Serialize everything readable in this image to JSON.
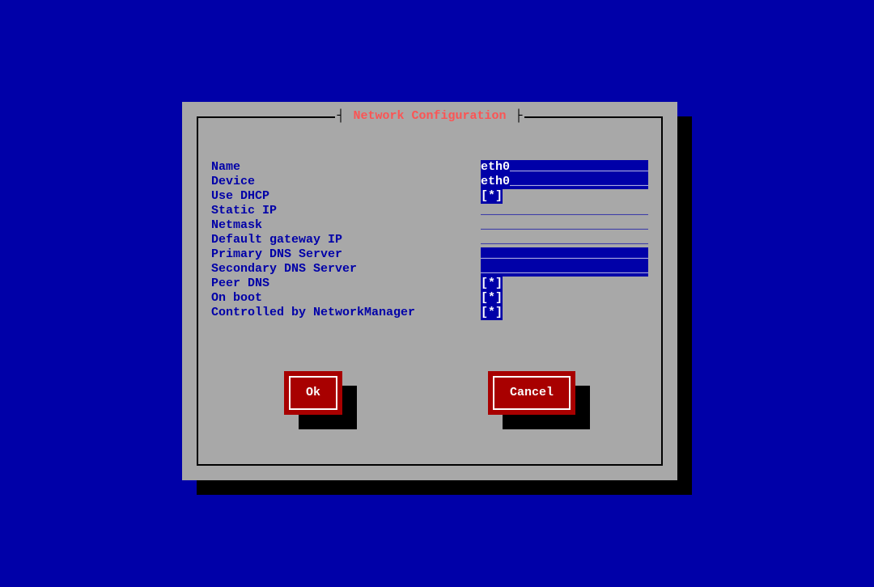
{
  "dialog": {
    "title": "Network Configuration",
    "bracket_left": "┤",
    "bracket_right": "├"
  },
  "fields": {
    "name": {
      "label": "Name",
      "value": "eth0",
      "style": "blue",
      "width_chars": 24
    },
    "device": {
      "label": "Device",
      "value": "eth0",
      "style": "blue",
      "width_chars": 24
    },
    "dhcp": {
      "label": "Use DHCP",
      "checked": true
    },
    "staticip": {
      "label": "Static IP",
      "value": "",
      "style": "underline",
      "width_chars": 24
    },
    "netmask": {
      "label": "Netmask",
      "value": "",
      "style": "underline",
      "width_chars": 24
    },
    "gateway": {
      "label": "Default gateway IP",
      "value": "",
      "style": "underline",
      "width_chars": 24
    },
    "dns1": {
      "label": "Primary DNS Server",
      "value": "",
      "style": "blue",
      "width_chars": 24
    },
    "dns2": {
      "label": "Secondary DNS Server",
      "value": "",
      "style": "blue",
      "width_chars": 24
    },
    "peerdns": {
      "label": "Peer DNS",
      "checked": true
    },
    "onboot": {
      "label": "On boot",
      "checked": true
    },
    "nm": {
      "label": "Controlled by NetworkManager",
      "checked": true
    }
  },
  "buttons": {
    "ok": "Ok",
    "cancel": "Cancel"
  },
  "glyphs": {
    "underscore": "_",
    "checkbox_open": "[",
    "checkbox_close": "]",
    "checkbox_mark": "*",
    "checkbox_space": " "
  }
}
